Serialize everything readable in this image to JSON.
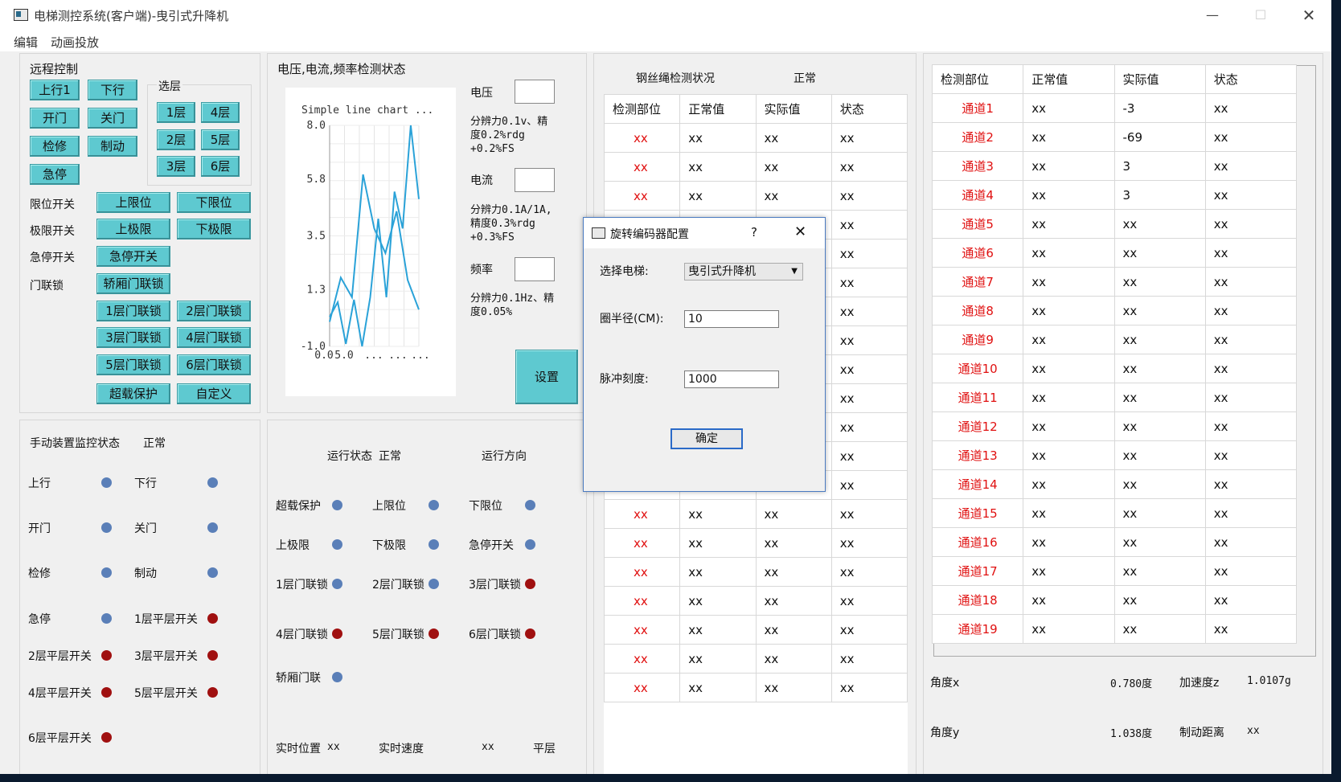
{
  "window": {
    "title": "电梯测控系统(客户端)-曳引式升降机"
  },
  "menu": {
    "edit": "编辑",
    "anim": "动画投放"
  },
  "remote": {
    "title": "远程控制",
    "floor_select_title": "选层",
    "btn_up1": "上行1",
    "btn_down": "下行",
    "btn_open": "开门",
    "btn_close": "关门",
    "btn_inspect": "检修",
    "btn_brake": "制动",
    "btn_estop": "急停",
    "floors": [
      "1层",
      "4层",
      "2层",
      "5层",
      "3层",
      "6层"
    ],
    "row_limit": "限位开关",
    "btn_upper_limit": "上限位",
    "btn_lower_limit": "下限位",
    "row_extreme": "极限开关",
    "btn_upper_extreme": "上极限",
    "btn_lower_extreme": "下极限",
    "row_estop": "急停开关",
    "btn_estop_switch": "急停开关",
    "row_door": "门联锁",
    "btn_car_door": "轿厢门联锁",
    "door_locks": [
      "1层门联锁",
      "2层门联锁",
      "3层门联锁",
      "4层门联锁",
      "5层门联锁",
      "6层门联锁"
    ],
    "btn_overload": "超载保护",
    "btn_custom": "自定义"
  },
  "vif": {
    "title": "电压,电流,频率检测状态",
    "voltage_label": "电压",
    "voltage_spec": [
      "分辨力0.1v、精",
      "度0.2%rdg",
      "+0.2%FS"
    ],
    "current_label": "电流",
    "current_spec": [
      "分辨力0.1A/1A,",
      "精度0.3%rdg",
      "+0.3%FS"
    ],
    "freq_label": "频率",
    "freq_spec": [
      "分辨力0.1Hz、精",
      "度0.05%"
    ],
    "set_button": "设置"
  },
  "chart_data": {
    "type": "line",
    "title": "Simple line chart ...",
    "ylim": [
      -1.0,
      8.0
    ],
    "yticks": [
      "8.0",
      "5.8",
      "3.5",
      "1.3",
      "-1.0"
    ],
    "xticks": [
      "0.0",
      "5.0",
      "...",
      "...",
      "..."
    ],
    "series": [
      {
        "values": [
          0.2,
          0.8,
          -0.9,
          0.9,
          -1.0,
          1.0,
          4.2,
          1.0,
          5.3,
          3.8,
          8.0,
          5.0
        ]
      },
      {
        "values": [
          0.0,
          1.8,
          1.0,
          6.0,
          3.8,
          2.8,
          4.5,
          1.7,
          0.5
        ]
      }
    ]
  },
  "manual": {
    "title": "手动装置监控状态",
    "status": "正常",
    "items": [
      {
        "label": "上行",
        "state": "blue"
      },
      {
        "label": "下行",
        "state": "blue"
      },
      {
        "label": "开门",
        "state": "blue"
      },
      {
        "label": "关门",
        "state": "blue"
      },
      {
        "label": "检修",
        "state": "blue"
      },
      {
        "label": "制动",
        "state": "blue"
      },
      {
        "label": "急停",
        "state": "blue"
      },
      {
        "label": "1层平层开关",
        "state": "red"
      },
      {
        "label": "2层平层开关",
        "state": "red"
      },
      {
        "label": "3层平层开关",
        "state": "red"
      },
      {
        "label": "4层平层开关",
        "state": "red"
      },
      {
        "label": "5层平层开关",
        "state": "red"
      },
      {
        "label": "6层平层开关",
        "state": "red"
      }
    ]
  },
  "run": {
    "status_label": "运行状态",
    "status": "正常",
    "direction_label": "运行方向",
    "items": [
      {
        "label": "超载保护",
        "state": "blue"
      },
      {
        "label": "上限位",
        "state": "blue"
      },
      {
        "label": "下限位",
        "state": "blue"
      },
      {
        "label": "上极限",
        "state": "blue"
      },
      {
        "label": "下极限",
        "state": "blue"
      },
      {
        "label": "急停开关",
        "state": "blue"
      },
      {
        "label": "1层门联锁",
        "state": "blue"
      },
      {
        "label": "2层门联锁",
        "state": "blue"
      },
      {
        "label": "3层门联锁",
        "state": "red"
      },
      {
        "label": "4层门联锁",
        "state": "red"
      },
      {
        "label": "5层门联锁",
        "state": "red"
      },
      {
        "label": "6层门联锁",
        "state": "red"
      },
      {
        "label": "轿厢门联",
        "state": "blue"
      }
    ],
    "position_label": "实时位置",
    "position_value": "xx",
    "speed_label": "实时速度",
    "speed_value": "xx",
    "level_label": "平层"
  },
  "rope": {
    "title": "钢丝绳检测状况",
    "status": "正常",
    "headers": [
      "检测部位",
      "正常值",
      "实际值",
      "状态"
    ],
    "row_count": 20,
    "cell": "xx"
  },
  "channels": {
    "headers": [
      "检测部位",
      "正常值",
      "实际值",
      "状态"
    ],
    "rows": [
      [
        "通道1",
        "xx",
        "-3",
        "xx"
      ],
      [
        "通道2",
        "xx",
        "-69",
        "xx"
      ],
      [
        "通道3",
        "xx",
        "3",
        "xx"
      ],
      [
        "通道4",
        "xx",
        "3",
        "xx"
      ],
      [
        "通道5",
        "xx",
        "xx",
        "xx"
      ],
      [
        "通道6",
        "xx",
        "xx",
        "xx"
      ],
      [
        "通道7",
        "xx",
        "xx",
        "xx"
      ],
      [
        "通道8",
        "xx",
        "xx",
        "xx"
      ],
      [
        "通道9",
        "xx",
        "xx",
        "xx"
      ],
      [
        "通道10",
        "xx",
        "xx",
        "xx"
      ],
      [
        "通道11",
        "xx",
        "xx",
        "xx"
      ],
      [
        "通道12",
        "xx",
        "xx",
        "xx"
      ],
      [
        "通道13",
        "xx",
        "xx",
        "xx"
      ],
      [
        "通道14",
        "xx",
        "xx",
        "xx"
      ],
      [
        "通道15",
        "xx",
        "xx",
        "xx"
      ],
      [
        "通道16",
        "xx",
        "xx",
        "xx"
      ],
      [
        "通道17",
        "xx",
        "xx",
        "xx"
      ],
      [
        "通道18",
        "xx",
        "xx",
        "xx"
      ],
      [
        "通道19",
        "xx",
        "xx",
        "xx"
      ]
    ]
  },
  "sensors": {
    "angle_x_label": "角度x",
    "angle_x_value": "0.780度",
    "accel_z_label": "加速度z",
    "accel_z_value": "1.0107g",
    "angle_y_label": "角度y",
    "angle_y_value": "1.038度",
    "brake_dist_label": "制动距离",
    "brake_dist_value": "xx"
  },
  "dialog": {
    "title": "旋转编码器配置",
    "help": "?",
    "elevator_label": "选择电梯:",
    "elevator_value": "曳引式升降机",
    "radius_label": "圈半径(CM):",
    "radius_value": "10",
    "pulse_label": "脉冲刻度:",
    "pulse_value": "1000",
    "ok_button": "确定"
  },
  "colors": {
    "button": "#5ec9d0",
    "dot_off": "#5a7fb8",
    "dot_on": "#a01010",
    "channel_text": "#e01010"
  }
}
